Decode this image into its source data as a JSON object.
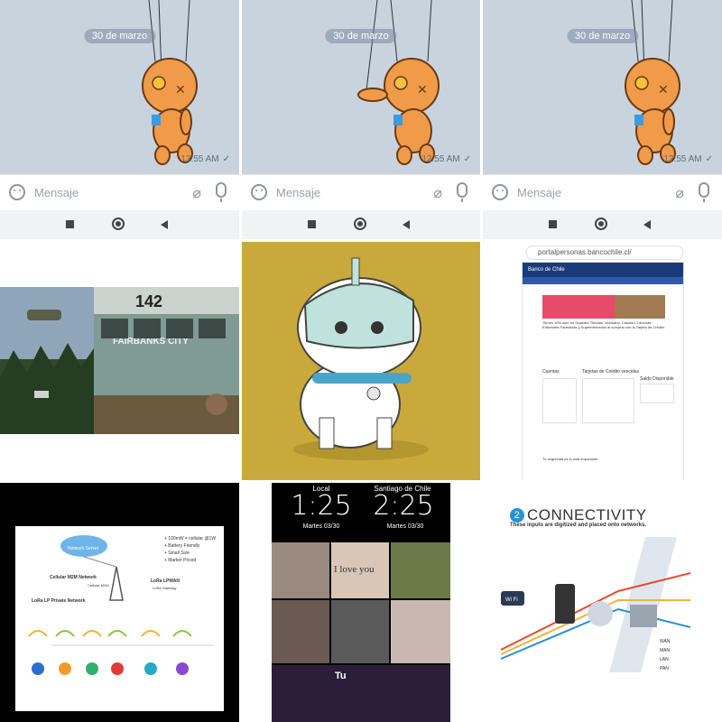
{
  "grid": {
    "chat_cells": [
      {
        "date": "30 de marzo",
        "time": "12:55 AM",
        "placeholder": "Mensaje",
        "check": "✓"
      },
      {
        "date": "30 de marzo",
        "time": "12:55 AM",
        "placeholder": "Mensaje",
        "check": "✓"
      },
      {
        "date": "30 de marzo",
        "time": "12:55 AM",
        "placeholder": "Mensaje",
        "check": "✓"
      }
    ],
    "photo_cell": {
      "bus_number": "142",
      "bus_sign": "FAIRBANKS CITY"
    },
    "bank_cell": {
      "url": "portalpersonas.bancochile.cl/",
      "bank_name": "Banco de Chile",
      "promo_text": "Tienes 10% dcto en Grandes Tiendas, Vestuario, Calzado, Librerías, Editoriales Farmacias y Supermercados al comprar con la Tarjeta de Crédito",
      "cuentas_label": "Cuentas",
      "tarjetas_label": "Tarjetas de Crédito vencidas",
      "saldo_label": "Saldo Disponible",
      "aviso": "Tu seguridad es lo más importante"
    },
    "network_cell": {
      "cloud_label": "Network Server",
      "bullets": [
        "+ 100mW = cellular @1W",
        "+ Battery Friendly",
        "+ Small Size",
        "+ Market Priced"
      ],
      "cellular_label": "Cellular M2M Network",
      "lora_lp_label": "LoRa LP Private Network",
      "lora_wan_label": "LoRa LPWAN",
      "cellular_device": "Cellular M2M",
      "lora_gateway": "LoRa Gateway"
    },
    "clock_cell": {
      "city_left": "Local",
      "city_right": "Santiago de Chile",
      "time_left": "1:25",
      "time_right": "2:25",
      "date_left": "Martes 03/30",
      "date_right": "Martes 03/30",
      "love_text": "I love you",
      "tu_text": "Tu"
    },
    "connectivity_cell": {
      "number": "2",
      "title": "CONNECTIVITY",
      "subtitle": "These inputs are digitized and placed onto networks.",
      "wifi_label": "Wi Fi",
      "net_labels": [
        "WAN",
        "MAN",
        "LAN",
        "PAN"
      ]
    }
  },
  "colors": {
    "chat_bg": "#c8d3de",
    "doll": "#f09b4a",
    "dog_bg": "#c9a93b",
    "network_bg": "#000000",
    "clock_bg": "#000000"
  }
}
